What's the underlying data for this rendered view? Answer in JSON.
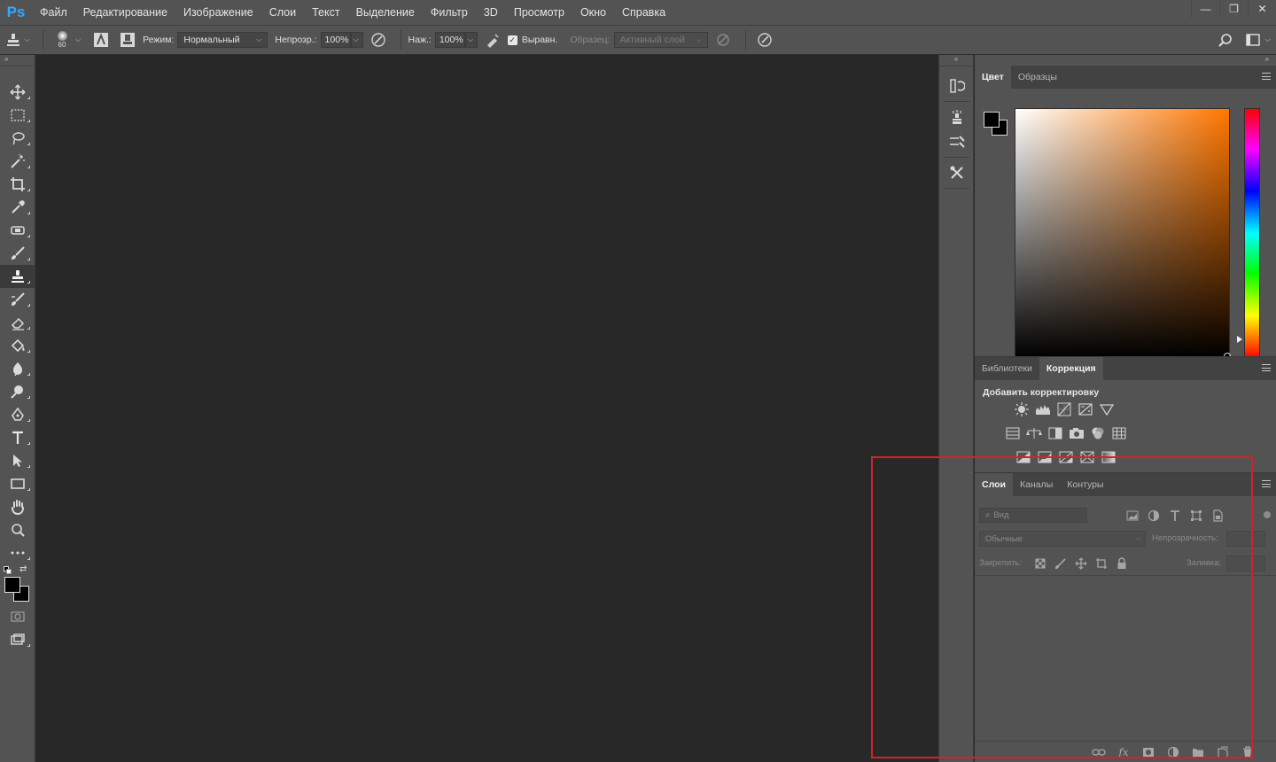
{
  "app": {
    "logo": "Ps"
  },
  "menu": [
    "Файл",
    "Редактирование",
    "Изображение",
    "Слои",
    "Текст",
    "Выделение",
    "Фильтр",
    "3D",
    "Просмотр",
    "Окно",
    "Справка"
  ],
  "window_controls": {
    "minimize": "—",
    "restore": "❐",
    "close": "✕"
  },
  "options": {
    "brush_size": "60",
    "mode_label": "Режим:",
    "mode_value": "Нормальный",
    "opacity_label": "Непрозр.:",
    "opacity_value": "100%",
    "flow_label": "Наж.:",
    "flow_value": "100%",
    "aligned_label": "Выравн.",
    "aligned_checked": true,
    "sample_label": "Образец:",
    "sample_value": "Активный слой"
  },
  "color_panel": {
    "tabs": [
      "Цвет",
      "Образцы"
    ],
    "active_tab": "Цвет",
    "foreground": "#000000",
    "background": "#000000"
  },
  "adjust_panel": {
    "tabs": [
      "Библиотеки",
      "Коррекция"
    ],
    "active_tab": "Коррекция",
    "title": "Добавить корректировку"
  },
  "layers_panel": {
    "tabs": [
      "Слои",
      "Каналы",
      "Контуры"
    ],
    "active_tab": "Слои",
    "search_placeholder": "Вид",
    "blend_mode": "Обычные",
    "opacity_label": "Непрозрачность:",
    "lock_label": "Закрепить:",
    "fill_label": "Заливка:"
  },
  "highlight_color": "#d72129"
}
